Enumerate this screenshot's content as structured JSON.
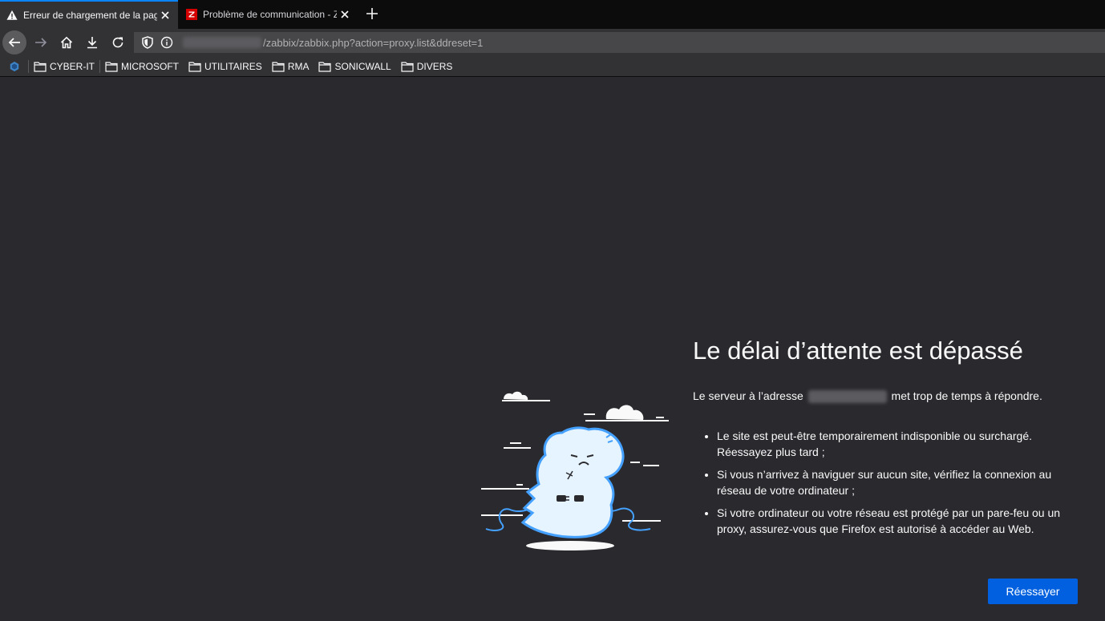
{
  "tabs": [
    {
      "label": "Erreur de chargement de la page",
      "active": true,
      "icon": "warning-icon"
    },
    {
      "label": "Problème de communication - Zabbix",
      "active": false,
      "icon": "zabbix-icon"
    }
  ],
  "urlbar": {
    "url_path": "/zabbix/zabbix.php?action=proxy.list&ddreset=1"
  },
  "bookmarks": [
    {
      "label": "CYBER-IT"
    },
    {
      "label": "MICROSOFT"
    },
    {
      "label": "UTILITAIRES"
    },
    {
      "label": "RMA"
    },
    {
      "label": "SONICWALL"
    },
    {
      "label": "DIVERS"
    }
  ],
  "error": {
    "title": "Le délai d’attente est dépassé",
    "desc_before": "Le serveur à l’adresse",
    "desc_after": "met trop de temps à répondre.",
    "items": [
      "Le site est peut-être temporairement indisponible ou surchargé. Réessayez plus tard ;",
      "Si vous n’arrivez à naviguer sur aucun site, vérifiez la connexion au réseau de votre ordinateur ;",
      "Si votre ordinateur ou votre réseau est protégé par un pare-feu ou un proxy, assurez-vous que Firefox est autorisé à accéder au Web."
    ],
    "retry_label": "Réessayer"
  },
  "colors": {
    "accent": "#0a84ff",
    "button": "#0060df",
    "page_bg": "#2a2a2e"
  }
}
